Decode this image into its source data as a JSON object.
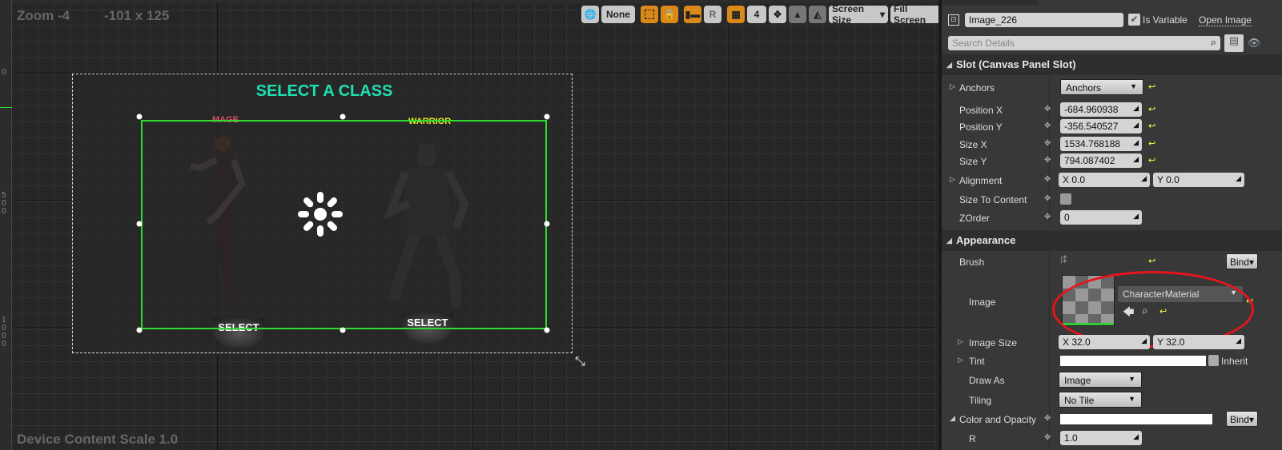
{
  "viewport": {
    "zoom_label": "Zoom -4",
    "size_label": "-101 x 125",
    "scale_label": "Device Content Scale 1.0",
    "ruler_labels": [
      "0",
      "5\n0\n0",
      "1\n0\n0\n0"
    ]
  },
  "toolbar": {
    "locale": "None",
    "grid_snap": "4",
    "r_label": "R",
    "screen_size": "Screen Size",
    "fill_screen": "Fill Screen"
  },
  "widget": {
    "title": "SELECT A CLASS",
    "class_left": "MAGE",
    "class_right": "WARRIOR",
    "select_left": "SELECT",
    "select_right": "SELECT",
    "colors": {
      "title": "#1de0b0",
      "mage": "#e0506a",
      "warrior": "#e8f020",
      "selection": "#2ddc2d"
    }
  },
  "details": {
    "name": "Image_226",
    "is_variable_label": "Is Variable",
    "is_variable": true,
    "open_label": "Open Image",
    "search_placeholder": "Search Details",
    "slot_section": "Slot (Canvas Panel Slot)",
    "anchors": {
      "label": "Anchors",
      "value": "Anchors"
    },
    "position_x": {
      "label": "Position X",
      "value": "-684.960938"
    },
    "position_y": {
      "label": "Position Y",
      "value": "-356.540527"
    },
    "size_x": {
      "label": "Size X",
      "value": "1534.768188"
    },
    "size_y": {
      "label": "Size Y",
      "value": "794.087402"
    },
    "alignment": {
      "label": "Alignment",
      "x": "X  0.0",
      "y": "Y  0.0"
    },
    "size_to_content": {
      "label": "Size To Content",
      "checked": false
    },
    "zorder": {
      "label": "ZOrder",
      "value": "0"
    },
    "appearance_section": "Appearance",
    "brush": {
      "label": "Brush",
      "bind": "Bind"
    },
    "image": {
      "label": "Image",
      "value": "CharacterMaterial"
    },
    "image_size": {
      "label": "Image Size",
      "x": "X  32.0",
      "y": "Y  32.0"
    },
    "tint": {
      "label": "Tint",
      "inherit": "Inherit"
    },
    "draw_as": {
      "label": "Draw As",
      "value": "Image"
    },
    "tiling": {
      "label": "Tiling",
      "value": "No Tile"
    },
    "color_opacity": {
      "label": "Color and Opacity",
      "bind": "Bind"
    },
    "r": {
      "label": "R",
      "value": "1.0"
    }
  }
}
